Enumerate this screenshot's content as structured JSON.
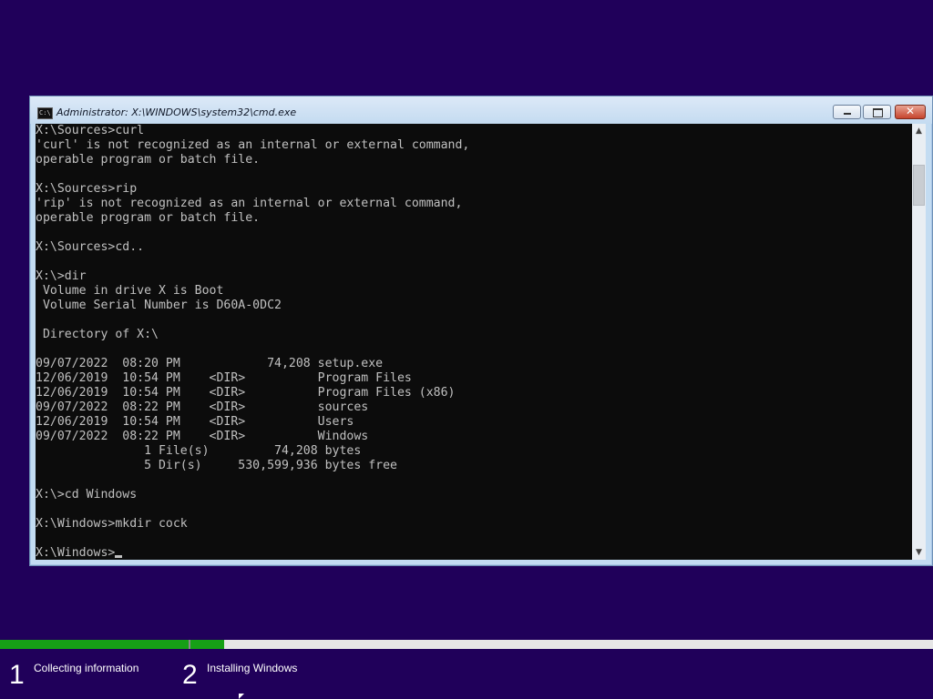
{
  "window": {
    "title": "Administrator: X:\\WINDOWS\\system32\\cmd.exe",
    "icon": "cmd-icon",
    "icon_text": "C:\\",
    "close_glyph": "✕"
  },
  "console": {
    "lines": [
      "X:\\Sources>curl",
      "'curl' is not recognized as an internal or external command,",
      "operable program or batch file.",
      "",
      "X:\\Sources>rip",
      "'rip' is not recognized as an internal or external command,",
      "operable program or batch file.",
      "",
      "X:\\Sources>cd..",
      "",
      "X:\\>dir",
      " Volume in drive X is Boot",
      " Volume Serial Number is D60A-0DC2",
      "",
      " Directory of X:\\",
      "",
      "09/07/2022  08:20 PM            74,208 setup.exe",
      "12/06/2019  10:54 PM    <DIR>          Program Files",
      "12/06/2019  10:54 PM    <DIR>          Program Files (x86)",
      "09/07/2022  08:22 PM    <DIR>          sources",
      "12/06/2019  10:54 PM    <DIR>          Users",
      "09/07/2022  08:22 PM    <DIR>          Windows",
      "               1 File(s)         74,208 bytes",
      "               5 Dir(s)     530,599,936 bytes free",
      "",
      "X:\\>cd Windows",
      "",
      "X:\\Windows>mkdir cock",
      ""
    ],
    "prompt": "X:\\Windows>"
  },
  "scrollbar": {
    "up_glyph": "▲",
    "down_glyph": "▼"
  },
  "setup": {
    "progress": [
      {
        "step": 1,
        "fill_fraction": 1.0
      },
      {
        "step": 2,
        "fill_fraction": 0.045
      }
    ],
    "steps": [
      {
        "number": "1",
        "label": "Collecting information"
      },
      {
        "number": "2",
        "label": "Installing Windows"
      }
    ]
  },
  "colors": {
    "desktop_background": "#20005a",
    "console_background": "#0c0c0c",
    "console_text": "#c0c0c0",
    "progress_fill": "#16a016"
  }
}
